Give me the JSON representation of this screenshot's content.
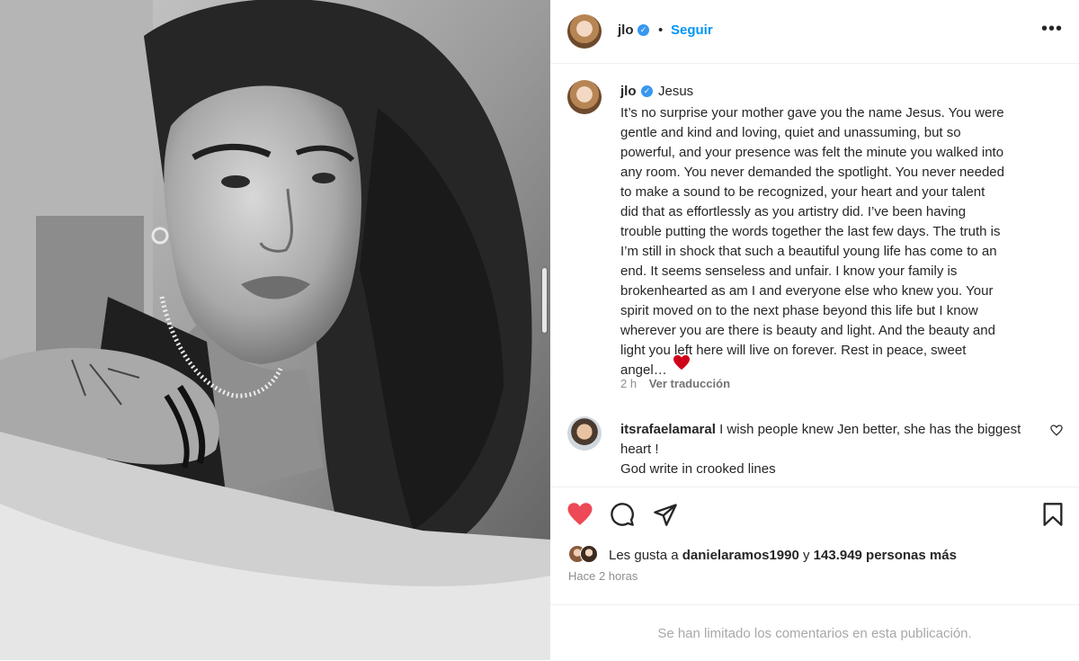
{
  "post": {
    "photo_alt": "Black and white portrait of a young man with long wavy hair",
    "header": {
      "username": "jlo",
      "separator": "•",
      "follow_label": "Seguir",
      "more_label": "•••"
    },
    "caption": {
      "username": "jlo",
      "title": "Jesus",
      "body": "It’s no surprise your mother gave you the name Jesus. You were\ngentle and kind and loving, quiet and unassuming, but so\npowerful, and your presence was felt the minute you walked into\nany room. You never demanded the spotlight. You never needed\nto make a sound to be recognized, your heart and your talent\ndid that as effortlessly as you artistry did. I’ve been having\ntrouble putting the words together the last few days. The truth is\nI’m still in shock that such a beautiful young life has come to an\nend. It seems senseless and unfair. I know your family is\nbrokenhearted as am I and everyone else who knew you. Your\nspirit moved on to the next phase beyond this life but I know\nwherever you are there is beauty and light. And the beauty and\nlight you left here will live on forever. Rest in peace, sweet\nangel…",
      "time": "2 h",
      "see_translation": "Ver traducción"
    },
    "comment": {
      "username": "itsrafaelamaral",
      "text": " I wish people knew Jen better, she has the biggest heart !",
      "text2": "God write in crooked lines"
    },
    "likes": {
      "prefix": "Les gusta a ",
      "user": "danielaramos1990",
      "middle": " y ",
      "count": "143.949 personas más"
    },
    "time_ago": "Hace 2 horas",
    "footer_note": "Se han limitado los comentarios en esta publicación."
  },
  "colors": {
    "accent_blue": "#0095f6",
    "like_red": "#ed4956",
    "muted": "#8e8e8e"
  },
  "icons": [
    "verified-badge-icon",
    "more-options-icon",
    "heart-filled-icon",
    "comment-icon",
    "share-icon",
    "bookmark-icon",
    "comment-like-icon",
    "red-heart-emoji"
  ]
}
